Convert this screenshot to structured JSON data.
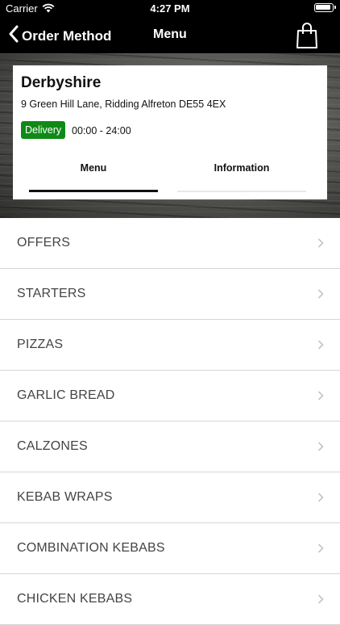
{
  "status_bar": {
    "carrier": "Carrier",
    "time": "4:27 PM",
    "icons": [
      "wifi-icon",
      "battery-icon"
    ]
  },
  "nav": {
    "back_label": "Order Method",
    "title": "Menu",
    "cart_icon": "shopping-bag-icon"
  },
  "store": {
    "name": "Derbyshire",
    "address": "9 Green Hill Lane, Ridding Alfreton DE55 4EX",
    "badge": "Delivery",
    "badge_color": "#0f8a17",
    "hours": "00:00 - 24:00"
  },
  "tabs": [
    {
      "label": "Menu",
      "active": true
    },
    {
      "label": "Information",
      "active": false
    }
  ],
  "categories": [
    {
      "label": "OFFERS"
    },
    {
      "label": "STARTERS"
    },
    {
      "label": "PIZZAS"
    },
    {
      "label": "GARLIC BREAD"
    },
    {
      "label": "CALZONES"
    },
    {
      "label": "KEBAB WRAPS"
    },
    {
      "label": "COMBINATION KEBABS"
    },
    {
      "label": "CHICKEN KEBABS"
    }
  ]
}
